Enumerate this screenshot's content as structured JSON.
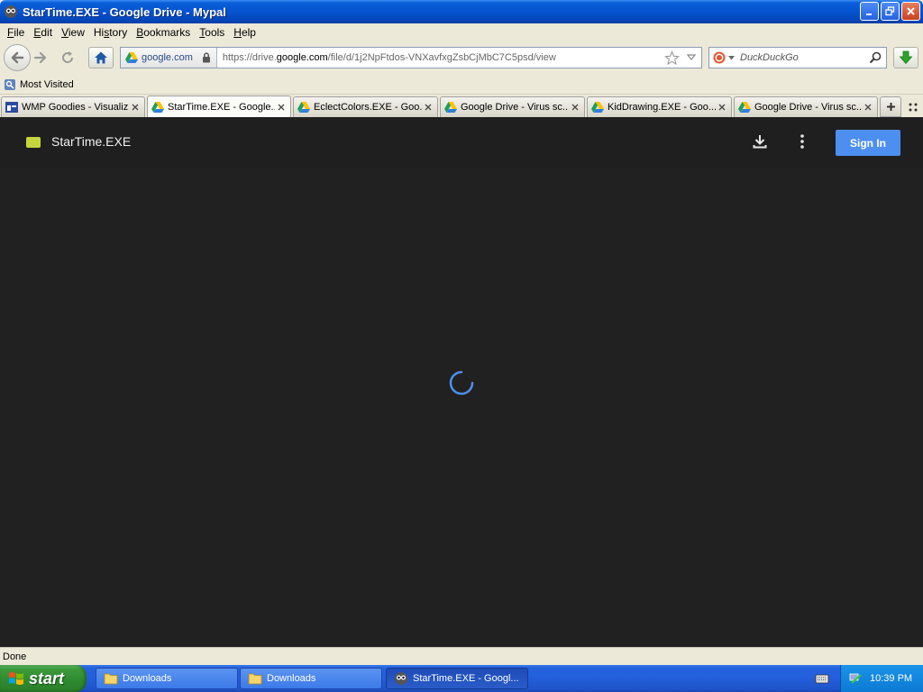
{
  "window": {
    "title": "StarTime.EXE - Google Drive - Mypal"
  },
  "menu": {
    "items": [
      {
        "pre": "",
        "key": "F",
        "post": "ile"
      },
      {
        "pre": "",
        "key": "E",
        "post": "dit"
      },
      {
        "pre": "",
        "key": "V",
        "post": "iew"
      },
      {
        "pre": "Hi",
        "key": "s",
        "post": "tory"
      },
      {
        "pre": "",
        "key": "B",
        "post": "ookmarks"
      },
      {
        "pre": "",
        "key": "T",
        "post": "ools"
      },
      {
        "pre": "",
        "key": "H",
        "post": "elp"
      }
    ]
  },
  "nav": {
    "identity_domain": "google.com",
    "url_prefix": "https://drive.",
    "url_host": "google.com",
    "url_path": "/file/d/1j2NpFtdos-VNXavfxgZsbCjMbC7C5psd/view",
    "search_placeholder": "DuckDuckGo"
  },
  "bookmarks": {
    "most_visited": "Most Visited"
  },
  "tabs": [
    {
      "label": "WMP Goodies - Visualiz...",
      "icon": "wmp-icon",
      "active": false
    },
    {
      "label": "StarTime.EXE - Google...",
      "icon": "google-drive-icon",
      "active": true
    },
    {
      "label": "EclectColors.EXE - Goo...",
      "icon": "google-drive-icon",
      "active": false
    },
    {
      "label": "Google Drive - Virus sc...",
      "icon": "google-drive-icon",
      "active": false
    },
    {
      "label": "KidDrawing.EXE - Goo...",
      "icon": "google-drive-icon",
      "active": false
    },
    {
      "label": "Google Drive - Virus sc...",
      "icon": "google-drive-icon",
      "active": false
    }
  ],
  "drive": {
    "file_name": "StarTime.EXE",
    "sign_in_label": "Sign In",
    "file_icon_color": "#c4d63c",
    "accent": "#4d8ff0"
  },
  "status": {
    "text": "Done"
  },
  "taskbar": {
    "start_label": "start",
    "buttons": [
      {
        "label": "Downloads",
        "icon": "folder-icon",
        "active": false
      },
      {
        "label": "Downloads",
        "icon": "folder-icon",
        "active": false
      },
      {
        "label": "StarTime.EXE - Googl...",
        "icon": "mypal-icon",
        "active": true
      }
    ],
    "clock": "10:39 PM"
  }
}
